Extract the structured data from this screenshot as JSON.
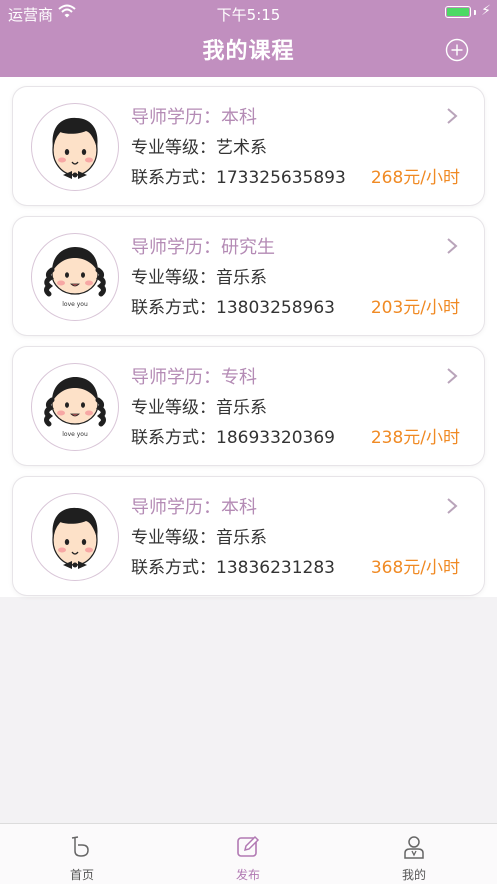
{
  "status_bar": {
    "carrier": "运营商",
    "time": "下午5:15",
    "battery_level": 1.0
  },
  "header": {
    "title": "我的课程"
  },
  "courses": [
    {
      "education": "导师学历：本科",
      "department": "专业等级：艺术系",
      "contact": "联系方式：173325635893",
      "price": "268元/小时",
      "avatar": "boy-avatar"
    },
    {
      "education": "导师学历：研究生",
      "department": "专业等级：音乐系",
      "contact": "联系方式：13803258963",
      "price": "203元/小时",
      "avatar": "girl-avatar"
    },
    {
      "education": "导师学历：专科",
      "department": "专业等级：音乐系",
      "contact": "联系方式：18693320369",
      "price": "238元/小时",
      "avatar": "girl-avatar"
    },
    {
      "education": "导师学历：本科",
      "department": "专业等级：音乐系",
      "contact": "联系方式：13836231283",
      "price": "368元/小时",
      "avatar": "boy-avatar"
    }
  ],
  "avatar_caption": "love you",
  "tabbar": {
    "items": [
      {
        "label": "首页",
        "icon": "home-icon"
      },
      {
        "label": "发布",
        "icon": "publish-icon",
        "active": true
      },
      {
        "label": "我的",
        "icon": "profile-icon"
      }
    ]
  },
  "colors": {
    "header": "#c18fbf",
    "accent": "#b48bb5",
    "price": "#f08a24",
    "tab_active": "#b179b3"
  }
}
